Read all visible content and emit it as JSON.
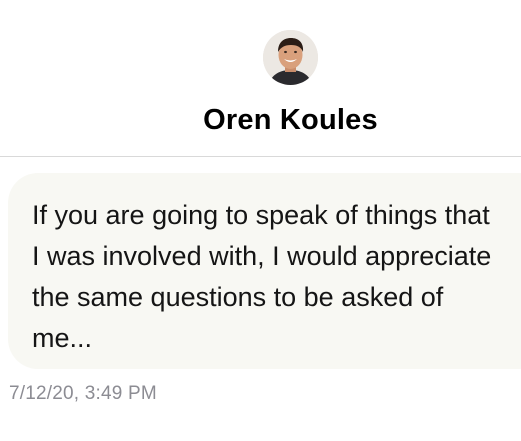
{
  "contact": {
    "name": "Oren Koules",
    "avatar_icon": "profile-photo"
  },
  "messages": [
    {
      "text": "If you are going to speak of things that I was involved with, I would appreciate the same questions to be asked of me...",
      "timestamp": "7/12/20, 3:49 PM"
    }
  ],
  "colors": {
    "background": "#ffffff",
    "bubble": "#f8f8f3",
    "divider": "#d9d9d9",
    "timestamp": "#8c8c93",
    "name": "#000000"
  }
}
